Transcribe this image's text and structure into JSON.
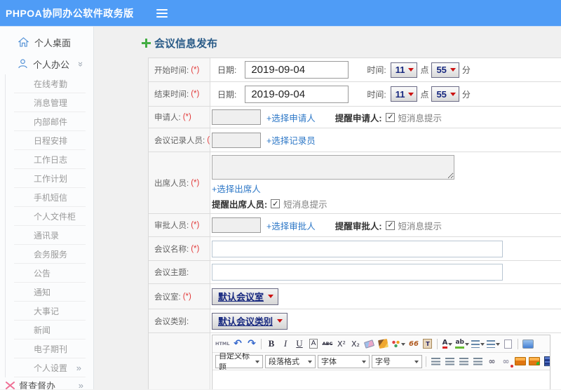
{
  "topbar": {
    "title": "PHPOA协同办公软件政务版"
  },
  "sidebar": {
    "desktop_label": "个人桌面",
    "office_label": "个人办公",
    "office_items": [
      "在线考勤",
      "消息管理",
      "内部邮件",
      "日程安排",
      "工作日志",
      "工作计划",
      "手机短信",
      "个人文件柜",
      "通讯录",
      "会务服务",
      "公告",
      "通知",
      "大事记",
      "新闻",
      "电子期刊"
    ],
    "settings_label": "个人设置",
    "supervise_label": "督查督办"
  },
  "page": {
    "title": "会议信息发布"
  },
  "form": {
    "start": {
      "label": "开始时间:",
      "req": "(*)",
      "date_label": "日期:",
      "date_value": "2019-09-04",
      "time_label": "时间:",
      "hour": "11",
      "hour_unit": "点",
      "minute": "55",
      "minute_unit": "分"
    },
    "end": {
      "label": "结束时间:",
      "req": "(*)",
      "date_label": "日期:",
      "date_value": "2019-09-04",
      "time_label": "时间:",
      "hour": "11",
      "hour_unit": "点",
      "minute": "55",
      "minute_unit": "分"
    },
    "applicant": {
      "label": "申请人:",
      "req": "(*)",
      "link": "+选择申请人",
      "remind_label": "提醒申请人:",
      "sms_label": "短消息提示"
    },
    "recorder": {
      "label": "会议记录人员:",
      "req": "(*)",
      "link": "+选择记录员"
    },
    "attendee": {
      "label": "出席人员:",
      "req": "(*)",
      "link": "+选择出席人",
      "remind_label": "提醒出席人员:",
      "sms_label": "短消息提示"
    },
    "approver": {
      "label": "审批人员:",
      "req": "(*)",
      "link": "+选择审批人",
      "remind_label": "提醒审批人:",
      "sms_label": "短消息提示"
    },
    "name": {
      "label": "会议名称:",
      "req": "(*)"
    },
    "subject": {
      "label": "会议主题:"
    },
    "room": {
      "label": "会议室:",
      "req": "(*)",
      "value": "默认会议室"
    },
    "category": {
      "label": "会议类别:",
      "value": "默认会议类别"
    }
  },
  "editor": {
    "html_label": "HTML",
    "bold": "B",
    "italic": "I",
    "underline": "U",
    "font_box": "A",
    "strike": "ABC",
    "sup": "X²",
    "sub": "X₂",
    "quote": "66",
    "fontcolor": "A",
    "highlight": "ab",
    "heading_select": "自定义标题",
    "format_select": "段落格式",
    "font_select": "字体",
    "size_select": "字号"
  }
}
